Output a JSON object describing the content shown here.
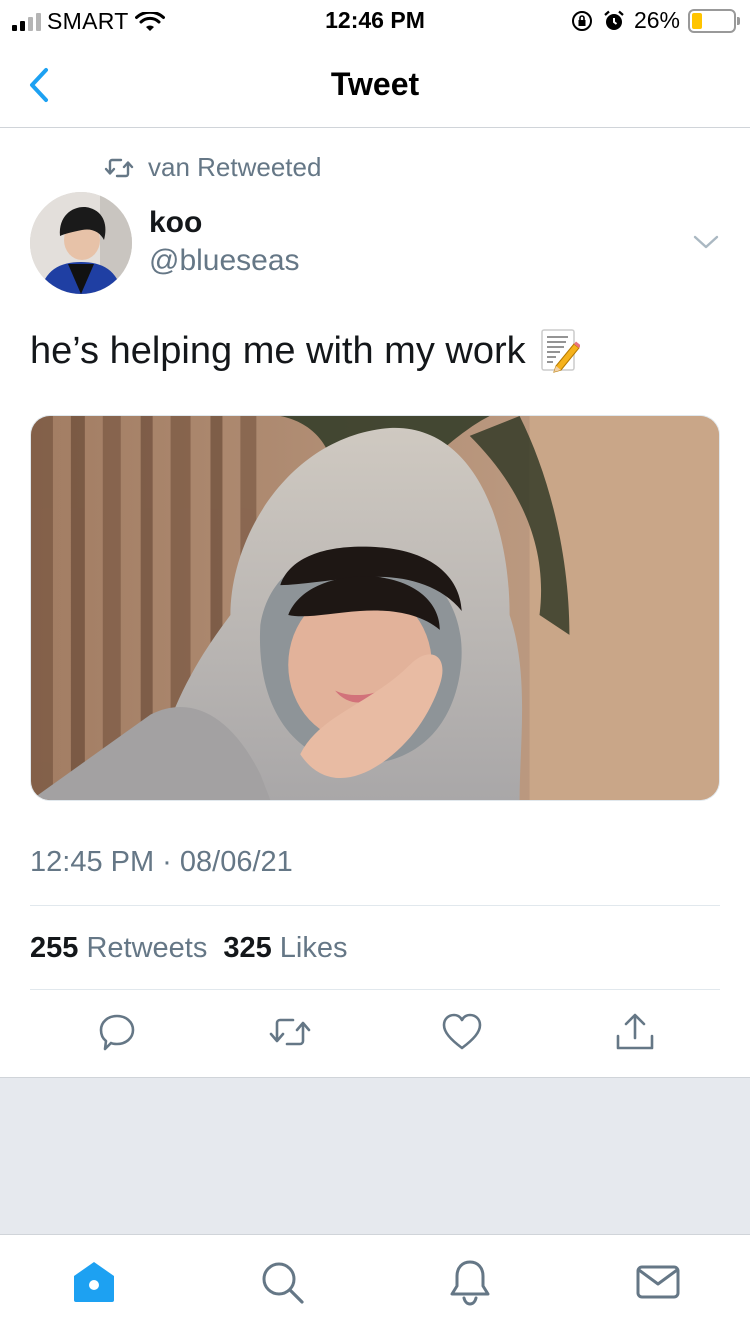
{
  "status_bar": {
    "carrier": "SMART",
    "time": "12:46 PM",
    "battery_percent": "26%",
    "battery_level": 0.26,
    "icons": [
      "signal-icon",
      "wifi-icon",
      "rotation-lock-icon",
      "alarm-icon",
      "battery-icon"
    ]
  },
  "nav": {
    "title": "Tweet",
    "back_icon": "chevron-left-icon"
  },
  "tweet": {
    "retweeted_by": "van Retweeted",
    "author_name": "koo",
    "author_handle": "@blueseas",
    "text": "he’s helping me with my work",
    "emoji_icon": "memo-icon",
    "timestamp": "12:45 PM · 08/06/21",
    "retweets_count": "255",
    "retweets_label": "Retweets",
    "likes_count": "325",
    "likes_label": "Likes"
  },
  "actions": [
    "reply-icon",
    "retweet-icon",
    "like-icon",
    "share-icon"
  ],
  "tabbar": [
    "home-icon",
    "search-icon",
    "notifications-icon",
    "messages-icon"
  ],
  "colors": {
    "accent": "#1da1f2",
    "secondary_text": "#657786",
    "primary_text": "#14171a",
    "background_grey": "#e6e9ee"
  }
}
